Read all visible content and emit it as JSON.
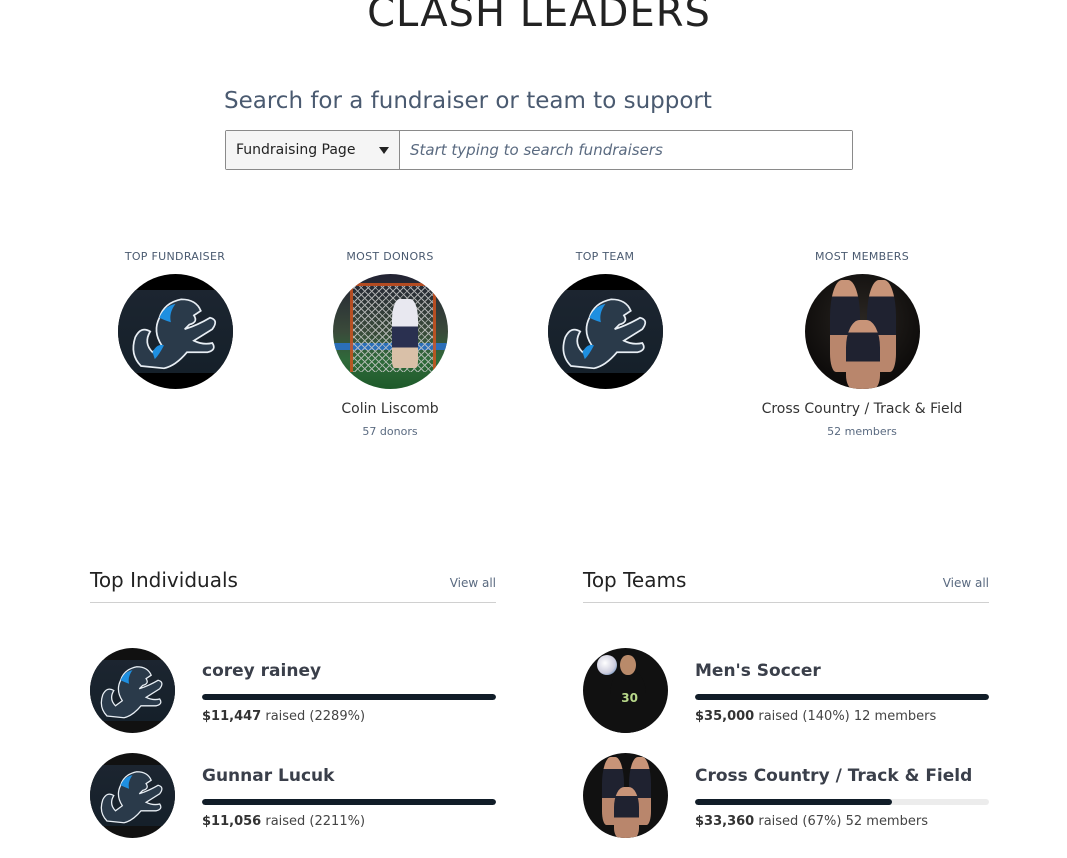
{
  "page": {
    "title": "CLASH LEADERS",
    "search_heading": "Search for a fundraiser or team to support"
  },
  "search": {
    "type_selected": "Fundraising Page",
    "placeholder": "Start typing to search fundraisers",
    "value": ""
  },
  "leaders": [
    {
      "label": "TOP FUNDRAISER",
      "image": "lion-logo",
      "name": "",
      "sub": ""
    },
    {
      "label": "MOST DONORS",
      "image": "lacrosse-player-photo",
      "name": "Colin Liscomb",
      "sub": "57 donors"
    },
    {
      "label": "TOP TEAM",
      "image": "lion-logo",
      "name": "",
      "sub": ""
    },
    {
      "label": "MOST MEMBERS",
      "image": "track-team-photo",
      "name": "Cross Country / Track & Field",
      "sub": "52 members"
    }
  ],
  "top_individuals": {
    "title": "Top Individuals",
    "view_all": "View all",
    "items": [
      {
        "name": "corey rainey",
        "amount": "$11,447",
        "raised_text": " raised (2289%)",
        "progress_percent": 2289,
        "image": "lion-logo"
      },
      {
        "name": "Gunnar Lucuk",
        "amount": "$11,056",
        "raised_text": " raised (2211%)",
        "progress_percent": 2211,
        "image": "lion-logo"
      }
    ]
  },
  "top_teams": {
    "title": "Top Teams",
    "view_all": "View all",
    "items": [
      {
        "name": "Men's Soccer",
        "amount": "$35,000",
        "raised_text": " raised (140%) 12 members",
        "progress_percent": 140,
        "image": "soccer-player-photo"
      },
      {
        "name": "Cross Country / Track & Field",
        "amount": "$33,360",
        "raised_text": " raised (67%) 52 members",
        "progress_percent": 67,
        "image": "track-team-photo"
      }
    ]
  },
  "colors": {
    "progress_fill": "#111d28",
    "progress_track": "#ececec",
    "muted_text": "#4a5a70"
  }
}
